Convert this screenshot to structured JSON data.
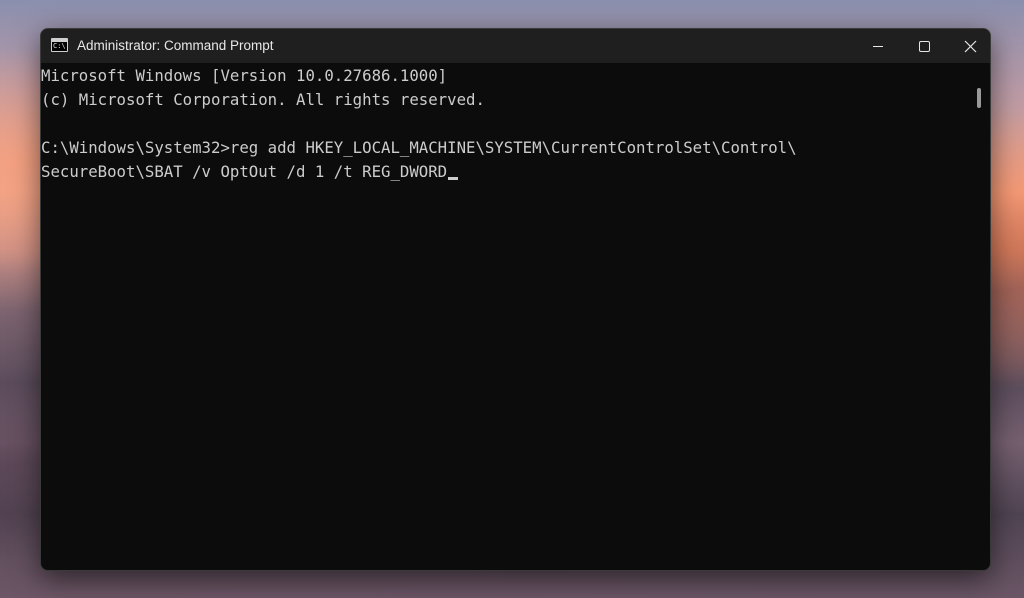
{
  "window": {
    "title": "Administrator: Command Prompt",
    "icon_label": "C:\\",
    "controls": {
      "minimize": "minimize-icon",
      "maximize": "maximize-icon",
      "close": "close-icon"
    }
  },
  "console": {
    "lines": [
      "Microsoft Windows [Version 10.0.27686.1000]",
      "(c) Microsoft Corporation. All rights reserved.",
      "",
      "C:\\Windows\\System32>reg add HKEY_LOCAL_MACHINE\\SYSTEM\\CurrentControlSet\\Control\\",
      "SecureBoot\\SBAT /v OptOut /d 1 /t REG_DWORD"
    ],
    "text_color": "#cccccc",
    "background": "#0c0c0c"
  }
}
